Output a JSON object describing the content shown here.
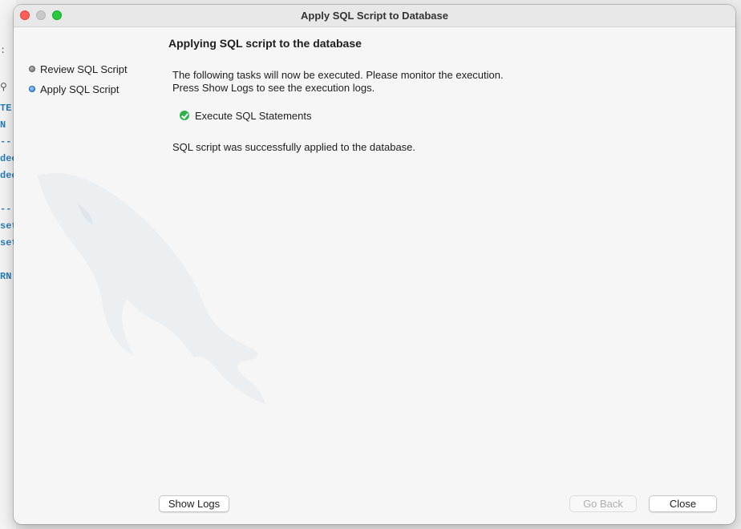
{
  "background_editor": {
    "fragments": [
      ":",
      "TE",
      "N",
      "--",
      "dec",
      "dec",
      "--",
      "set",
      "set",
      "RN"
    ]
  },
  "window": {
    "title": "Apply SQL Script to Database"
  },
  "sidebar": {
    "steps": [
      {
        "label": "Review SQL Script",
        "state": "done"
      },
      {
        "label": "Apply SQL Script",
        "state": "current"
      }
    ]
  },
  "main": {
    "heading": "Applying SQL script to the database",
    "description_line1": "The following tasks will now be executed. Please monitor the execution.",
    "description_line2": "Press Show Logs to see the execution logs.",
    "tasks": [
      {
        "label": "Execute SQL Statements",
        "status": "success",
        "icon": "check-circle-icon"
      }
    ],
    "result_message": "SQL script was successfully applied to the database."
  },
  "buttons": {
    "show_logs": "Show Logs",
    "go_back": "Go Back",
    "close": "Close"
  },
  "colors": {
    "success": "#2db34a",
    "close_traffic": "#fe5f57",
    "zoom_traffic": "#28c840",
    "code_text": "#2b7db8"
  }
}
